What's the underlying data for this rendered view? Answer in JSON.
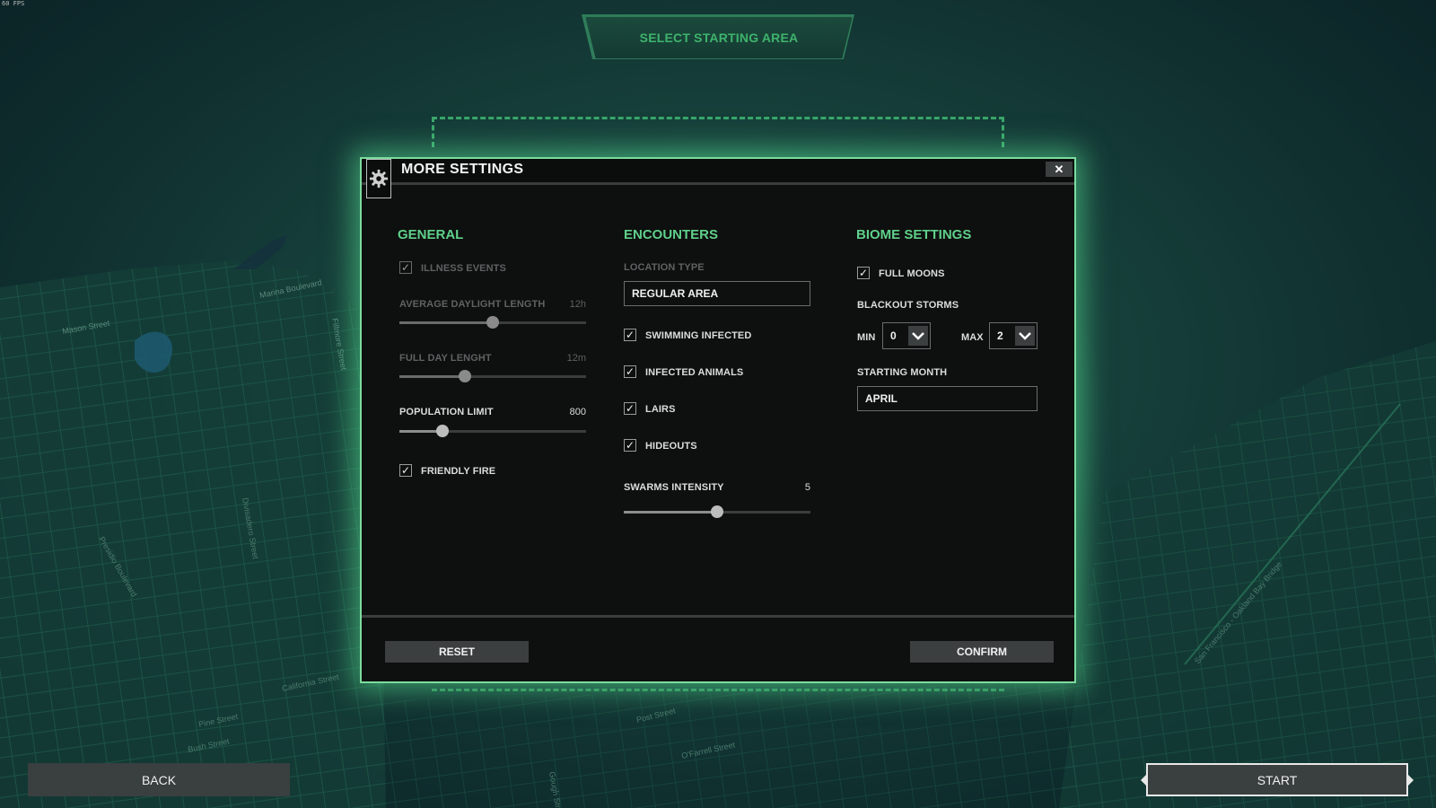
{
  "hud": {
    "fps": "60 FPS",
    "banner": "SELECT STARTING AREA"
  },
  "dialog": {
    "title": "MORE SETTINGS",
    "close_icon": "close-icon",
    "gear_icon": "gear-icon",
    "general": {
      "heading": "GENERAL",
      "illness_events": {
        "label": "ILLNESS EVENTS",
        "checked": true,
        "disabled": true
      },
      "daylight": {
        "label": "AVERAGE DAYLIGHT LENGTH",
        "value": "12h",
        "fraction": 0.5,
        "disabled": true
      },
      "full_day": {
        "label": "FULL DAY LENGHT",
        "value": "12m",
        "fraction": 0.35,
        "disabled": true
      },
      "population": {
        "label": "POPULATION LIMIT",
        "value": "800",
        "fraction": 0.23
      },
      "friendly_fire": {
        "label": "FRIENDLY FIRE",
        "checked": true
      }
    },
    "encounters": {
      "heading": "ENCOUNTERS",
      "location_type_label": "LOCATION TYPE",
      "location_type_value": "REGULAR AREA",
      "swimming_infected": {
        "label": "SWIMMING INFECTED",
        "checked": true
      },
      "infected_animals": {
        "label": "INFECTED ANIMALS",
        "checked": true
      },
      "lairs": {
        "label": "LAIRS",
        "checked": true
      },
      "hideouts": {
        "label": "HIDEOUTS",
        "checked": true
      },
      "swarms": {
        "label": "SWARMS INTENSITY",
        "value": "5",
        "fraction": 0.5
      }
    },
    "biome": {
      "heading": "BIOME SETTINGS",
      "full_moons": {
        "label": "FULL MOONS",
        "checked": true
      },
      "blackout_label": "BLACKOUT STORMS",
      "min_label": "MIN",
      "min_value": "0",
      "max_label": "MAX",
      "max_value": "2",
      "starting_month_label": "STARTING MONTH",
      "starting_month_value": "APRIL"
    },
    "reset_label": "RESET",
    "confirm_label": "CONFIRM"
  },
  "back_label": "BACK",
  "start_label": "START",
  "map_labels": [
    "Marina Boulevard",
    "Mason Street",
    "Fillmore Street",
    "Presidio Boulevard",
    "Divisadero Street",
    "California Street",
    "Pine Street",
    "Bush Street",
    "Post Street",
    "O'Farrell Street",
    "Gough Street",
    "San Francisco - Oakland Bay Bridge"
  ],
  "colors": {
    "accent": "#5fd08a",
    "glow": "#7bdc9e",
    "button": "#3c3f40"
  }
}
